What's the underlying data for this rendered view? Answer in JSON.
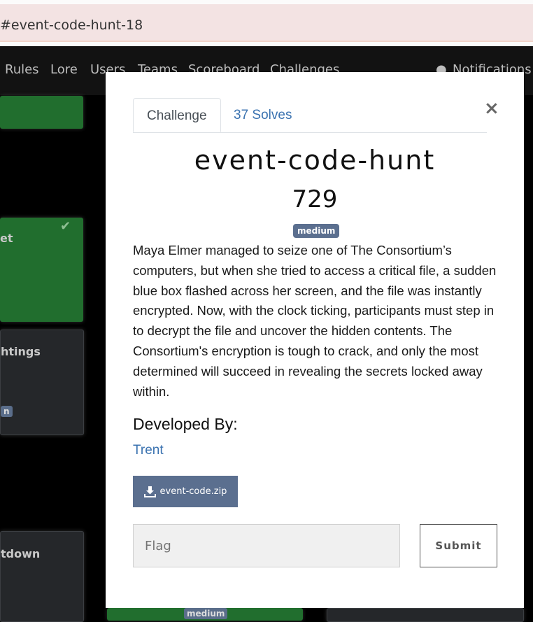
{
  "browser": {
    "url_fragment": "#event-code-hunt-18"
  },
  "nav": {
    "items": [
      "Rules",
      "Lore",
      "Users",
      "Teams",
      "Scoreboard",
      "Challenges"
    ],
    "notifications_label": "Notifications"
  },
  "background_cards": [
    {
      "label": "et"
    },
    {
      "label": "htings",
      "badge": "n"
    },
    {
      "label": "tdown"
    },
    {
      "badge": "medium"
    }
  ],
  "modal": {
    "tabs": [
      {
        "label": "Challenge",
        "active": true
      },
      {
        "label": "37 Solves",
        "active": false
      }
    ],
    "close_label": "×",
    "title": "event-code-hunt",
    "points": "729",
    "difficulty": "medium",
    "description": "Maya Elmer managed to seize one of The Consortium’s computers, but when she tried to access a critical file, a sudden blue box flashed across her screen, and the file was instantly encrypted. Now, with the clock ticking, participants must step in to decrypt the file and uncover the hidden contents. The Consortium's encryption is tough to crack, and only the most determined will succeed in revealing the secrets locked away within.",
    "developed_by_heading": "Developed By:",
    "developer": "Trent",
    "file": {
      "name": "event-code.zip",
      "icon": "download-icon"
    },
    "flag_placeholder": "Flag",
    "flag_value": "",
    "submit_label": "Submit"
  },
  "colors": {
    "accent_blue": "#3a72b0",
    "badge_slate": "#5b6f8f",
    "card_green": "#216e2e",
    "overlay": "#000000"
  }
}
